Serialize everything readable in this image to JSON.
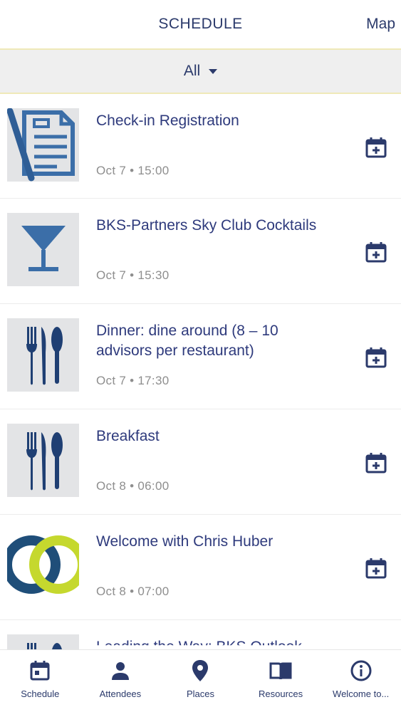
{
  "header": {
    "title": "SCHEDULE",
    "map_label": "Map"
  },
  "filter": {
    "selected": "All"
  },
  "colors": {
    "accent": "#2b3a6b",
    "title": "#2e3a7c",
    "muted": "#8e8e8e",
    "divider": "#efe9b8",
    "thumb_bg": "#e3e4e6",
    "lime": "#c5d82e",
    "teal": "#1f4e79"
  },
  "events": [
    {
      "title": "Check-in Registration",
      "time": "Oct 7 • 15:00",
      "icon": "document-icon"
    },
    {
      "title": "BKS-Partners Sky Club Cocktails",
      "time": "Oct 7 • 15:30",
      "icon": "cocktail-icon"
    },
    {
      "title": "Dinner: dine around (8 – 10 advisors per restaurant)",
      "time": "Oct 7 • 17:30",
      "icon": "cutlery-icon"
    },
    {
      "title": "Breakfast",
      "time": "Oct 8 • 06:00",
      "icon": "cutlery-icon"
    },
    {
      "title": "Welcome with Chris Huber",
      "time": "Oct 8 • 07:00",
      "icon": "logo-rings-icon"
    },
    {
      "title": "Leading the Way: BKS Outlook",
      "time": "",
      "icon": "cutlery-icon"
    }
  ],
  "tabs": [
    {
      "label": "Schedule",
      "icon": "calendar-icon"
    },
    {
      "label": "Attendees",
      "icon": "person-icon"
    },
    {
      "label": "Places",
      "icon": "map-pin-icon"
    },
    {
      "label": "Resources",
      "icon": "book-icon"
    },
    {
      "label": "Welcome to...",
      "icon": "info-icon"
    }
  ]
}
